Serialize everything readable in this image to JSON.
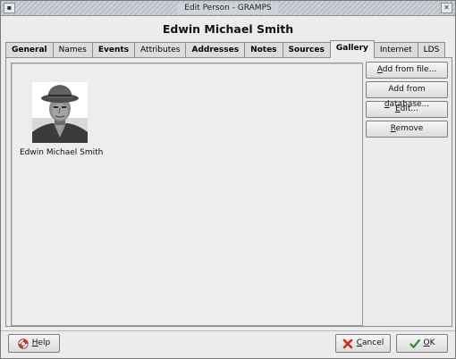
{
  "window": {
    "title": "Edit Person - GRAMPS"
  },
  "heading": "Edwin Michael Smith",
  "tabs": [
    {
      "label": "General",
      "active": false,
      "bold": true
    },
    {
      "label": "Names",
      "active": false,
      "bold": false
    },
    {
      "label": "Events",
      "active": false,
      "bold": true
    },
    {
      "label": "Attributes",
      "active": false,
      "bold": false
    },
    {
      "label": "Addresses",
      "active": false,
      "bold": true
    },
    {
      "label": "Notes",
      "active": false,
      "bold": true
    },
    {
      "label": "Sources",
      "active": false,
      "bold": true
    },
    {
      "label": "Gallery",
      "active": true,
      "bold": true
    },
    {
      "label": "Internet",
      "active": false,
      "bold": false
    },
    {
      "label": "LDS",
      "active": false,
      "bold": false
    }
  ],
  "gallery": {
    "items": [
      {
        "caption": "Edwin Michael Smith"
      }
    ]
  },
  "side_buttons": {
    "add_from_file": {
      "mnemonic": "A",
      "rest": "dd from file..."
    },
    "add_from_database": {
      "pre": "Add from ",
      "mnemonic": "d",
      "rest": "atabase..."
    },
    "edit": {
      "mnemonic": "E",
      "rest": "dit..."
    },
    "remove": {
      "mnemonic": "R",
      "rest": "emove"
    }
  },
  "footer": {
    "help": {
      "mnemonic": "H",
      "rest": "elp"
    },
    "cancel": {
      "mnemonic": "C",
      "rest": "ancel"
    },
    "ok": {
      "mnemonic": "O",
      "rest": "K"
    }
  },
  "icons": {
    "help": "lifebuoy-icon",
    "cancel": "red-x-icon",
    "ok": "green-check-icon"
  },
  "colors": {
    "cancel_icon": "#cc2a1e",
    "ok_icon": "#2e8b2e",
    "help_icon": "#d0382b"
  }
}
